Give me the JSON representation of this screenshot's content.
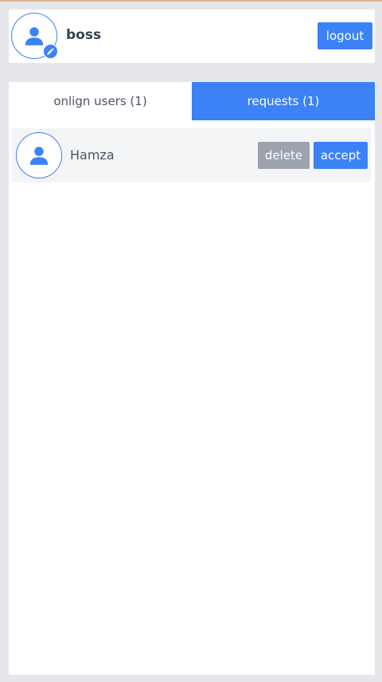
{
  "header": {
    "username": "boss",
    "logout_label": "logout",
    "avatar_icon": "user-icon",
    "edit_icon": "pencil-icon"
  },
  "tabs": [
    {
      "label": "onlign users (1)",
      "active": false
    },
    {
      "label": "requests (1)",
      "active": true
    }
  ],
  "requests": [
    {
      "name": "Hamza",
      "avatar_icon": "user-icon",
      "delete_label": "delete",
      "accept_label": "accept"
    }
  ],
  "colors": {
    "accent": "#3b82f6",
    "muted_button": "#9ca3af",
    "background": "#e5e7eb",
    "row_background": "#f3f4f6"
  }
}
